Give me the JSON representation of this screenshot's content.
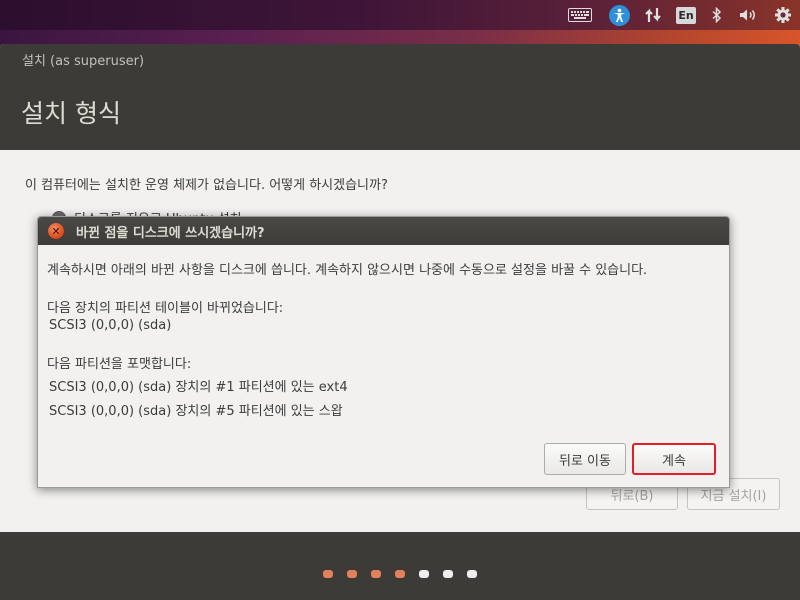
{
  "top_panel": {
    "indicators": [
      {
        "name": "keyboard-icon",
        "glyph": "⌨"
      },
      {
        "name": "accessibility-icon",
        "glyph": "♿"
      },
      {
        "name": "network-icon",
        "glyph": "⇅"
      },
      {
        "name": "language-indicator",
        "glyph": "En"
      },
      {
        "name": "bluetooth-icon",
        "glyph": "ᛒ"
      },
      {
        "name": "sound-icon",
        "glyph": "🔉"
      },
      {
        "name": "system-gear-icon",
        "glyph": "⚙"
      }
    ],
    "language_label": "En"
  },
  "window": {
    "title": "설치 (as superuser)",
    "page_title": "설치 형식",
    "question": "이 컴퓨터에는 설치한 운영 체제가 없습니다. 어떻게 하시겠습니까?",
    "option_label": "디스크를 지우고 Ubuntu 설치",
    "back_button": "뒤로(B)",
    "install_button": "지금 설치(I)"
  },
  "dialog": {
    "title": "바뀐 점을 디스크에 쓰시겠습니까?",
    "intro": "계속하시면 아래의 바뀐 사항을 디스크에 씁니다. 계속하지 않으시면 나중에 수동으로 설정을 바꿀 수 있습니다.",
    "partition_table_heading": "다음 장치의 파티션 테이블이 바뀌었습니다:",
    "partition_table_device": "SCSI3 (0,0,0) (sda)",
    "format_heading": "다음 파티션을 포맷합니다:",
    "format_items": [
      "SCSI3 (0,0,0) (sda) 장치의 #1 파티션에 있는 ext4",
      "SCSI3 (0,0,0) (sda) 장치의 #5 파티션에 있는 스왑"
    ],
    "back_button": "뒤로 이동",
    "continue_button": "계속"
  },
  "progress": {
    "total_steps": 7,
    "completed_steps": 4,
    "done_color": "#e2815a",
    "todo_color": "#f0efee"
  },
  "colors": {
    "accent_highlight": "#e01f2a",
    "titlebar": "#3c3b37",
    "window_bg": "#f2f1f0"
  }
}
